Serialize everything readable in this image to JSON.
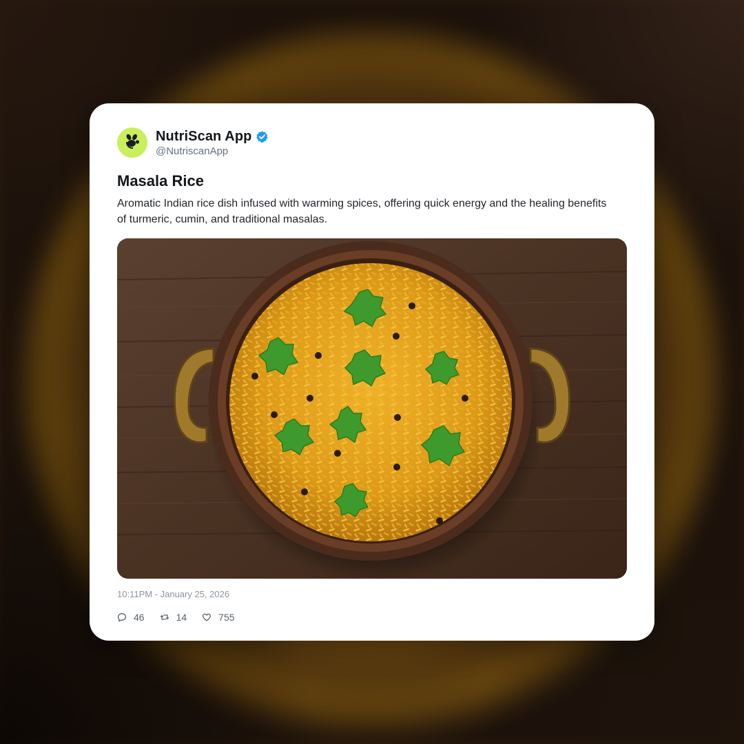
{
  "post": {
    "author": {
      "display_name": "NutriScan App",
      "handle": "@NutriscanApp",
      "verified": true,
      "avatar_icon": "nutriscan-logo-icon",
      "avatar_color": "#c9ef5e"
    },
    "title": "Masala Rice",
    "body": "Aromatic Indian rice dish infused with warming spices, offering quick energy and the healing benefits of turmeric, cumin, and traditional masalas.",
    "image": {
      "subject": "masala rice in copper pot with cilantro on wooden table"
    },
    "timestamp": "10:11PM - January 25, 2026",
    "stats": {
      "replies": "46",
      "reposts": "14",
      "likes": "755"
    }
  },
  "colors": {
    "verified_badge": "#1d9bf0",
    "card_background": "#ffffff"
  }
}
